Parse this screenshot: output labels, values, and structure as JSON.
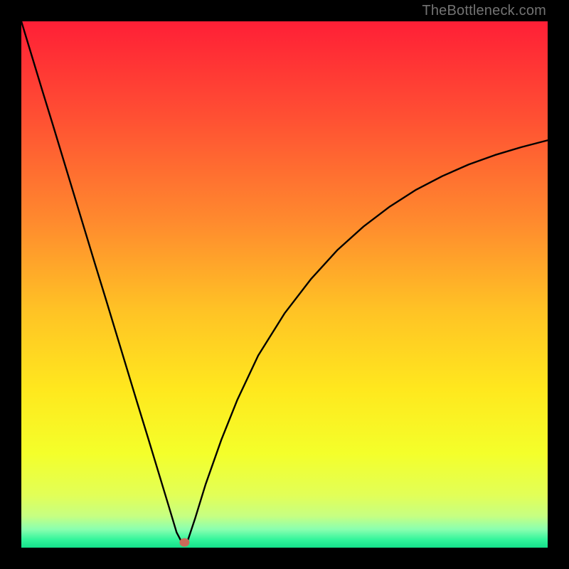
{
  "watermark": "TheBottleneck.com",
  "chart_data": {
    "type": "line",
    "title": "",
    "xlabel": "",
    "ylabel": "",
    "xlim": [
      0,
      100
    ],
    "ylim": [
      0,
      100
    ],
    "series": [
      {
        "name": "curve",
        "x": [
          0,
          2,
          4,
          6,
          8,
          10,
          12,
          14,
          16,
          18,
          20,
          22,
          24,
          26,
          28,
          29.5,
          30.5,
          31.5,
          33,
          35,
          38,
          41,
          45,
          50,
          55,
          60,
          65,
          70,
          75,
          80,
          85,
          90,
          95,
          100
        ],
        "y": [
          100,
          93.4,
          86.8,
          80.3,
          73.7,
          67.1,
          60.5,
          53.9,
          47.4,
          40.8,
          34.2,
          27.6,
          21.1,
          14.5,
          7.9,
          2.9,
          1.0,
          1.0,
          5.5,
          12.0,
          20.5,
          28.0,
          36.5,
          44.5,
          51.0,
          56.5,
          61.0,
          64.8,
          68.0,
          70.6,
          72.8,
          74.6,
          76.1,
          77.4
        ]
      }
    ],
    "marker": {
      "x": 31.0,
      "y": 1.0,
      "color": "#cb6a59"
    },
    "gradient_stops": [
      {
        "offset": 0.0,
        "color": "#ff1f36"
      },
      {
        "offset": 0.18,
        "color": "#ff4f33"
      },
      {
        "offset": 0.38,
        "color": "#ff8a2e"
      },
      {
        "offset": 0.55,
        "color": "#ffc325"
      },
      {
        "offset": 0.7,
        "color": "#ffe81e"
      },
      {
        "offset": 0.82,
        "color": "#f4ff2a"
      },
      {
        "offset": 0.9,
        "color": "#e2ff57"
      },
      {
        "offset": 0.94,
        "color": "#c6ff82"
      },
      {
        "offset": 0.965,
        "color": "#8affb0"
      },
      {
        "offset": 0.985,
        "color": "#32f59b"
      },
      {
        "offset": 1.0,
        "color": "#14e08a"
      }
    ]
  }
}
